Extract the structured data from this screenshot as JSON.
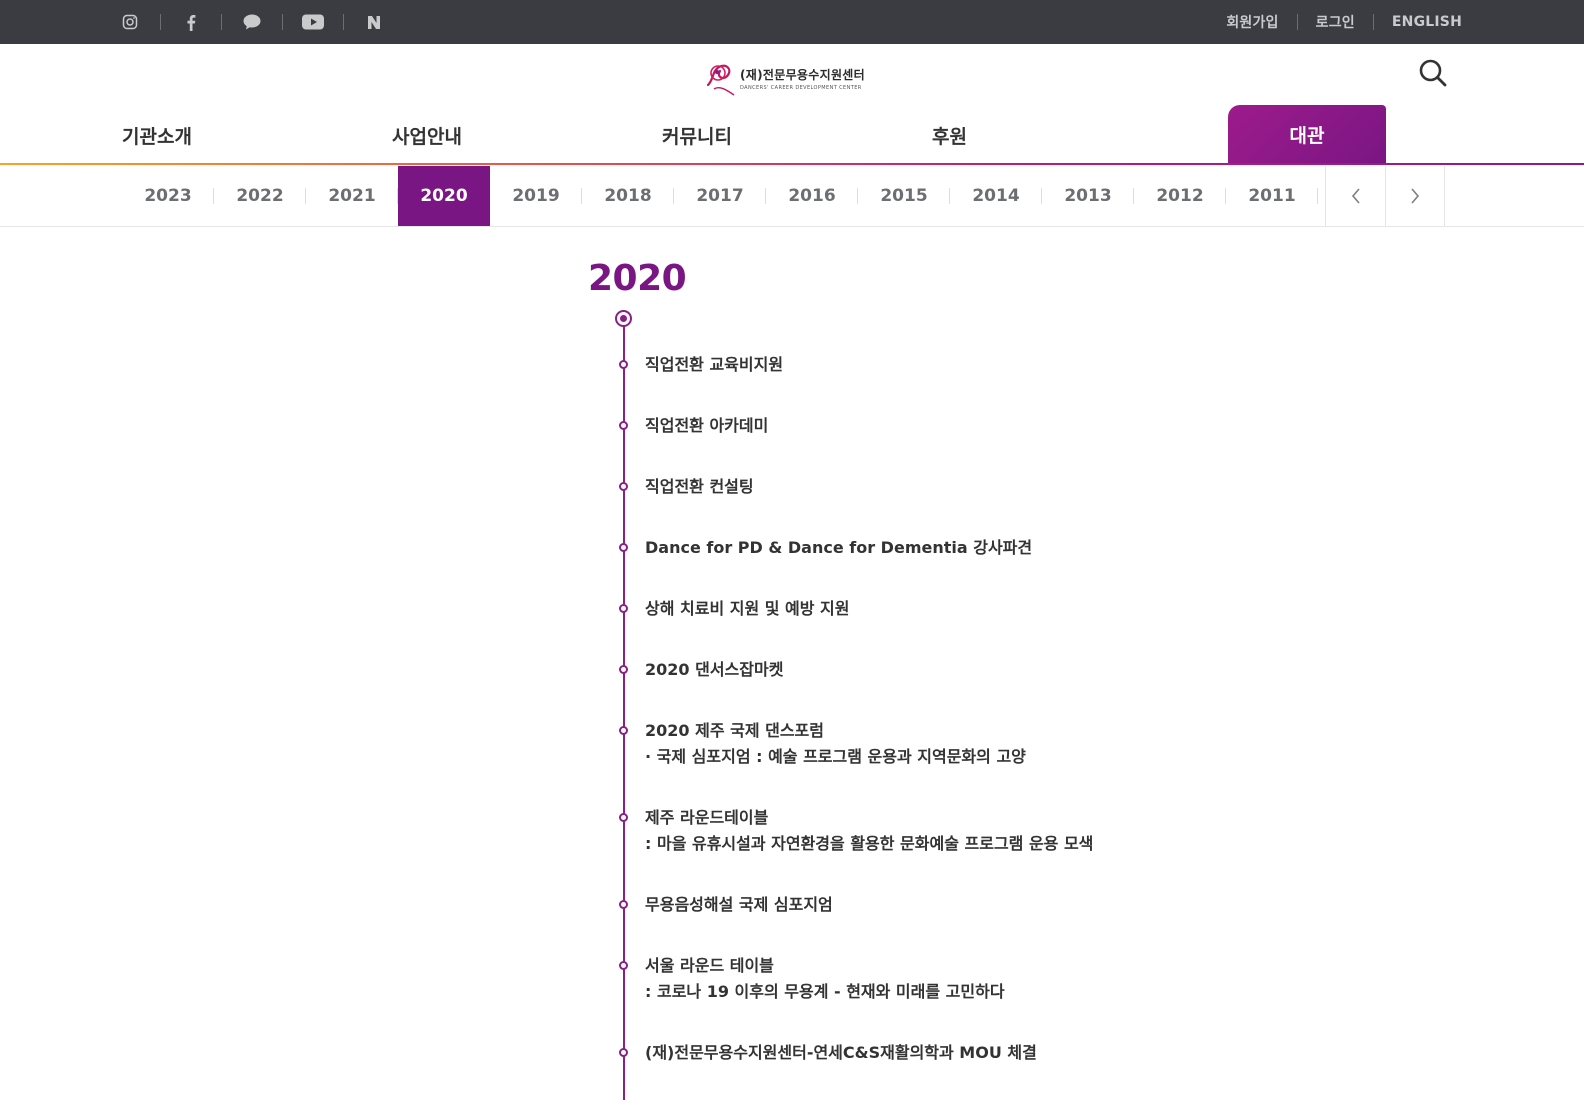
{
  "topbar": {
    "social": [
      {
        "name": "instagram-icon"
      },
      {
        "name": "facebook-icon"
      },
      {
        "name": "chat-icon"
      },
      {
        "name": "youtube-icon"
      },
      {
        "name": "naver-icon",
        "label": "N"
      }
    ],
    "links": [
      "회원가입",
      "로그인",
      "ENGLISH"
    ]
  },
  "header": {
    "logo_ko": "(재)전문무용수지원센터",
    "logo_en": "DANCERS' CAREER DEVELOPMENT CENTER"
  },
  "nav": {
    "items": [
      "기관소개",
      "사업안내",
      "커뮤니티",
      "후원",
      "대관"
    ],
    "active": "대관"
  },
  "years": {
    "items": [
      "2023",
      "2022",
      "2021",
      "2020",
      "2019",
      "2018",
      "2017",
      "2016",
      "2015",
      "2014",
      "2013",
      "2012",
      "2011"
    ],
    "active": "2020"
  },
  "timeline": {
    "year": "2020",
    "entries": [
      {
        "line1": "직업전환 교육비지원",
        "line2": ""
      },
      {
        "line1": "직업전환 아카데미",
        "line2": ""
      },
      {
        "line1": "직업전환 컨설팅",
        "line2": ""
      },
      {
        "line1": "Dance for PD & Dance for Dementia 강사파견",
        "line2": ""
      },
      {
        "line1": "상해 치료비 지원 및 예방 지원",
        "line2": ""
      },
      {
        "line1": "2020 댄서스잡마켓",
        "line2": ""
      },
      {
        "line1": "2020 제주 국제 댄스포럼",
        "line2": "· 국제 심포지엄 : 예술 프로그램 운용과 지역문화의 고양"
      },
      {
        "line1": "제주 라운드테이블",
        "line2": ": 마을 유휴시설과 자연환경을 활용한 문화예술 프로그램 운용 모색"
      },
      {
        "line1": "무용음성해설 국제 심포지엄",
        "line2": ""
      },
      {
        "line1": "서울 라운드 테이블",
        "line2": ": 코로나 19 이후의 무용계 - 현재와 미래를 고민하다"
      },
      {
        "line1": "(재)전문무용수지원센터-연세C&S재활의학과 MOU 체결",
        "line2": ""
      }
    ]
  },
  "colors": {
    "accent": "#7a1683",
    "topbar": "#3a3c41"
  }
}
